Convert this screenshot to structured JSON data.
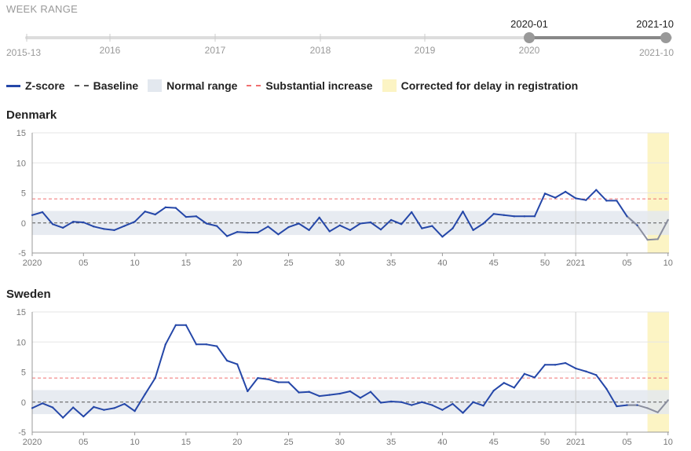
{
  "range_selector": {
    "title": "WEEK RANGE",
    "start_label": "2015-13",
    "end_label": "2021-10",
    "year_labels": [
      "2016",
      "2017",
      "2018",
      "2019",
      "2020"
    ],
    "selected_start": "2020-01",
    "selected_end": "2021-10",
    "colors": {
      "track": "#dddddd",
      "selected": "#888888",
      "handle": "#999999"
    }
  },
  "legend": {
    "zscore": "Z-score",
    "baseline": "Baseline",
    "normal_range": "Normal range",
    "substantial_increase": "Substantial increase",
    "corrected": "Corrected for delay in registration"
  },
  "colors": {
    "zscore": "#2547a8",
    "zscore_corrected": "#8a8e9e",
    "baseline": "#555555",
    "normal_range": "#e3e8ef",
    "substantial": "#f07070",
    "corrected_bg": "#fcf4c4",
    "grid": "#e6e6e6"
  },
  "chart_data": [
    {
      "type": "line",
      "title": "Denmark",
      "x_unit": "week (2020-01 to 2021-10)",
      "x_tick_labels": [
        "2020",
        "05",
        "10",
        "15",
        "20",
        "25",
        "30",
        "35",
        "40",
        "45",
        "50",
        "2021",
        "05",
        "10"
      ],
      "y_ticks": [
        "15",
        "10",
        "5",
        "0",
        "-5"
      ],
      "ylim": [
        -5,
        15
      ],
      "baseline": 0,
      "normal_range": [
        -2,
        2
      ],
      "substantial_increase": 4,
      "corrected_from_index": 60,
      "series": [
        {
          "values": [
            1.3,
            1.8,
            -0.2,
            -0.8,
            0.2,
            0.1,
            -0.6,
            -1.0,
            -1.2,
            -0.5,
            0.2,
            1.9,
            1.4,
            2.6,
            2.5,
            1.0,
            1.1,
            -0.1,
            -0.5,
            -2.2,
            -1.5,
            -1.6,
            -1.6,
            -0.6,
            -1.9,
            -0.7,
            -0.1,
            -1.2,
            0.9,
            -1.4,
            -0.4,
            -1.2,
            -0.1,
            0.1,
            -1.1,
            0.5,
            -0.2,
            1.8,
            -0.9,
            -0.5,
            -2.3,
            -0.9,
            1.9,
            -1.2,
            -0.1,
            1.5,
            1.3,
            1.1,
            1.1,
            1.1,
            4.9,
            4.2,
            5.2,
            4.1,
            3.8,
            5.5,
            3.7,
            3.7,
            1.1,
            -0.4,
            -2.8,
            -2.7,
            0.5
          ]
        }
      ]
    },
    {
      "type": "line",
      "title": "Sweden",
      "x_unit": "week (2020-01 to 2021-10)",
      "x_tick_labels": [
        "2020",
        "05",
        "10",
        "15",
        "20",
        "25",
        "30",
        "35",
        "40",
        "45",
        "50",
        "2021",
        "05",
        "10"
      ],
      "y_ticks": [
        "15",
        "10",
        "5",
        "0",
        "-5"
      ],
      "ylim": [
        -5,
        15
      ],
      "baseline": 0,
      "normal_range": [
        -2,
        2
      ],
      "substantial_increase": 4,
      "corrected_from_index": 60,
      "series": [
        {
          "values": [
            -1.0,
            -0.2,
            -0.9,
            -2.6,
            -0.9,
            -2.4,
            -0.8,
            -1.3,
            -1.0,
            -0.3,
            -1.5,
            1.3,
            4.0,
            9.6,
            12.8,
            12.8,
            9.6,
            9.6,
            9.3,
            6.9,
            6.3,
            1.8,
            4.0,
            3.8,
            3.3,
            3.3,
            1.6,
            1.7,
            1.0,
            1.2,
            1.4,
            1.8,
            0.7,
            1.7,
            -0.1,
            0.1,
            0.0,
            -0.5,
            0.0,
            -0.5,
            -1.3,
            -0.3,
            -1.8,
            0.0,
            -0.6,
            1.9,
            3.2,
            2.4,
            4.7,
            4.1,
            6.2,
            6.2,
            6.5,
            5.6,
            5.1,
            4.5,
            2.2,
            -0.7,
            -0.5,
            -0.5,
            -1.0,
            -1.7,
            0.3
          ]
        }
      ]
    }
  ]
}
